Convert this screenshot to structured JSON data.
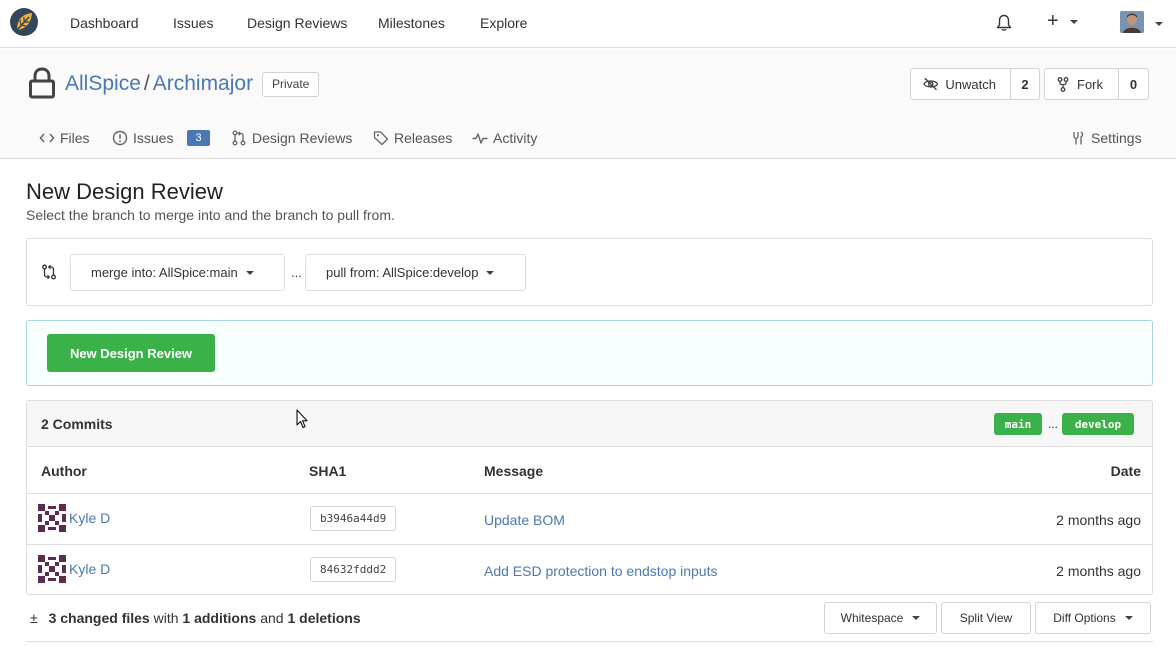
{
  "nav": {
    "items": [
      "Dashboard",
      "Issues",
      "Design Reviews",
      "Milestones",
      "Explore"
    ]
  },
  "repo": {
    "owner": "AllSpice",
    "separator": "/",
    "name": "Archimajor",
    "visibility": "Private",
    "watch_label": "Unwatch",
    "watch_count": "2",
    "fork_label": "Fork",
    "fork_count": "0"
  },
  "tabs": {
    "files": "Files",
    "issues": "Issues",
    "issues_count": "3",
    "design_reviews": "Design Reviews",
    "releases": "Releases",
    "activity": "Activity",
    "settings": "Settings"
  },
  "page": {
    "title": "New Design Review",
    "subtitle": "Select the branch to merge into and the branch to pull from."
  },
  "branches": {
    "merge_into": "merge into: AllSpice:main",
    "separator": "...",
    "pull_from": "pull from: AllSpice:develop"
  },
  "actions": {
    "new_design_review": "New Design Review"
  },
  "commits": {
    "title": "2 Commits",
    "base_tag": "main",
    "tag_separator": "...",
    "head_tag": "develop",
    "columns": {
      "author": "Author",
      "sha": "SHA1",
      "message": "Message",
      "date": "Date"
    },
    "rows": [
      {
        "author": "Kyle D",
        "sha": "b3946a44d9",
        "message": "Update BOM",
        "date": "2 months ago"
      },
      {
        "author": "Kyle D",
        "sha": "84632fddd2",
        "message": "Add ESD protection to endstop inputs",
        "date": "2 months ago"
      }
    ]
  },
  "diff": {
    "symbol": "±",
    "changed_files": "3 changed files",
    "with": "with",
    "additions": "1 additions",
    "and": "and",
    "deletions": "1 deletions",
    "whitespace": "Whitespace",
    "split_view": "Split View",
    "diff_options": "Diff Options"
  },
  "colors": {
    "accent": "#4b78b4",
    "green": "#3bb14a"
  }
}
